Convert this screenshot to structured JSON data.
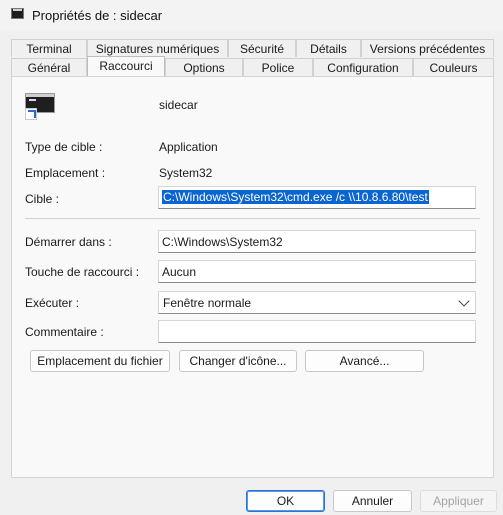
{
  "window": {
    "title": "Propriétés de : sidecar"
  },
  "tabs_back": [
    "Terminal",
    "Signatures numériques",
    "Sécurité",
    "Détails",
    "Versions précédentes"
  ],
  "tabs_front": [
    "Général",
    "Raccourci",
    "Options",
    "Police",
    "Configuration",
    "Couleurs"
  ],
  "active_tab": "Raccourci",
  "shortcut": {
    "name": "sidecar",
    "target_type_label": "Type de cible :",
    "target_type_value": "Application",
    "location_label": "Emplacement :",
    "location_value": "System32",
    "target_label": "Cible :",
    "target_value": "C:\\Windows\\System32\\cmd.exe /c \\\\10.8.6.80\\test",
    "start_in_label": "Démarrer dans :",
    "start_in_value": "C:\\Windows\\System32",
    "hotkey_label": "Touche de raccourci :",
    "hotkey_value": "Aucun",
    "run_label": "Exécuter :",
    "run_value": "Fenêtre normale",
    "comment_label": "Commentaire :",
    "comment_value": ""
  },
  "buttons": {
    "open_location": "Emplacement du fichier",
    "change_icon": "Changer d'icône...",
    "advanced": "Avancé..."
  },
  "footer": {
    "ok": "OK",
    "cancel": "Annuler",
    "apply": "Appliquer"
  }
}
